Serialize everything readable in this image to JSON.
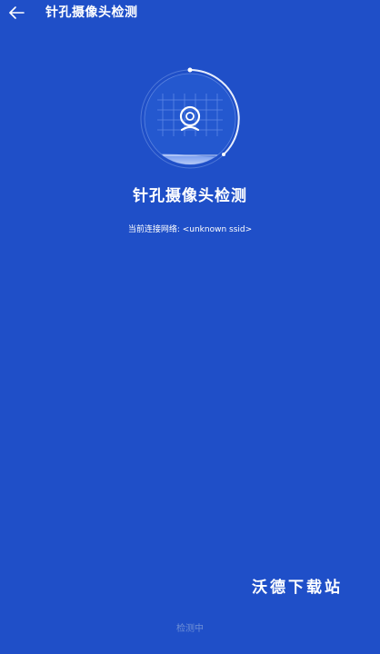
{
  "header": {
    "back_icon": "arrow-left-icon",
    "title": "针孔摄像头检测"
  },
  "scanner": {
    "icon": "webcam-icon",
    "ring_color": "#e8eefc",
    "accent": "#ffffff"
  },
  "main": {
    "heading": "针孔摄像头检测",
    "network_label": "当前连接网络:",
    "network_value": "<unknown ssid>"
  },
  "watermark": "沃德下载站",
  "footer": {
    "status_button": "检测中"
  },
  "colors": {
    "background": "#1f4fc8",
    "status_text": "#6f8fd6"
  }
}
